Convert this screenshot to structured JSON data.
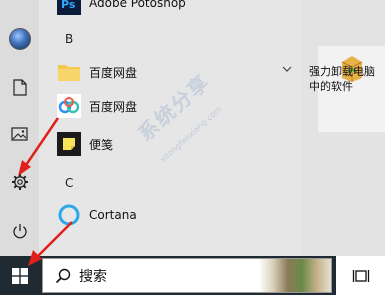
{
  "app_list": {
    "partial_top_item": "Adobe Potoshop",
    "section_b": "B",
    "baidu_folder": "百度网盘",
    "baidu_app": "百度网盘",
    "sticky_notes": "便笺",
    "section_c": "C",
    "cortana": "Cortana"
  },
  "tiles": {
    "uninstaller_label": "强力卸载电脑中的软件"
  },
  "taskbar": {
    "search_placeholder": "搜索"
  },
  "watermark": {
    "text": "系统分享",
    "url": "xitongfenxiang.com"
  },
  "colors": {
    "taskbar": "#1f2a33",
    "arrow": "#e0201b",
    "folder": "#f2c94c",
    "cortana_ring": "#2ca8e8"
  }
}
